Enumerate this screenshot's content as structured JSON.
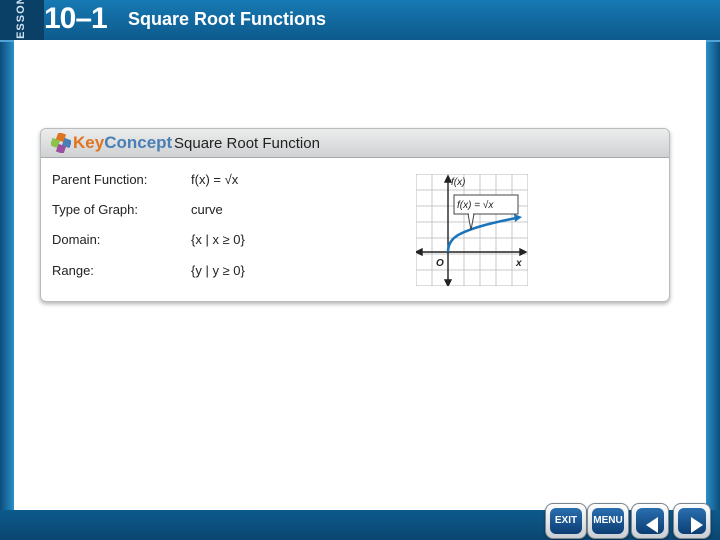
{
  "header": {
    "lesson_word": "LESSON",
    "lesson_number": "10–1",
    "title": "Square Root Functions"
  },
  "key_concept": {
    "logo_word_1": "Key",
    "logo_word_2": "Concept",
    "title": "Square Root Function",
    "rows": [
      {
        "label": "Parent Function:",
        "value": "f(x) = √x"
      },
      {
        "label": "Type of Graph:",
        "value": "curve"
      },
      {
        "label": "Domain:",
        "value": "{x | x ≥ 0}"
      },
      {
        "label": "Range:",
        "value": "{y | y ≥ 0}"
      }
    ],
    "graph": {
      "y_axis_label": "f(x)",
      "x_axis_label": "x",
      "origin_label": "O",
      "curve_label": "f(x) = √x"
    }
  },
  "footer": {
    "exit_label": "EXIT",
    "menu_label": "MENU"
  },
  "colors": {
    "header_blue": "#0d5a8c",
    "curve_blue": "#1b75bc",
    "key_orange": "#e0731f"
  }
}
